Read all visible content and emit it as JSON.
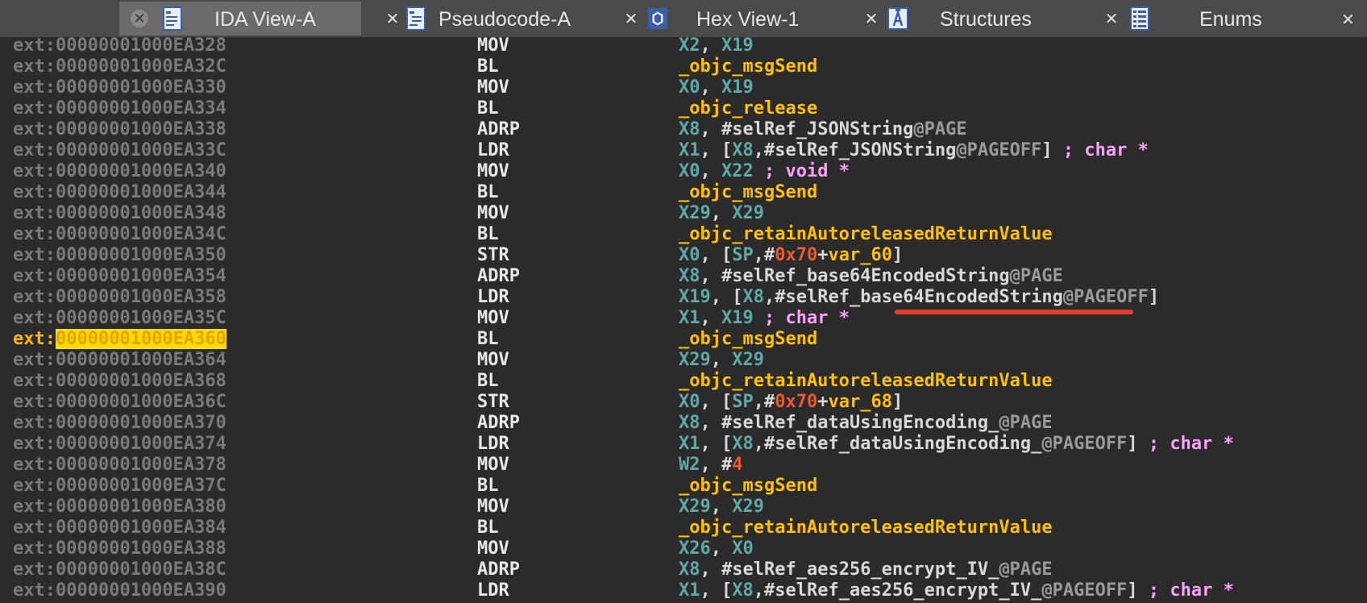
{
  "tabs": [
    {
      "label": "IDA View-A",
      "icon": "ida-view-icon",
      "active": true
    },
    {
      "label": "Pseudocode-A",
      "icon": "pseudocode-icon",
      "active": false
    },
    {
      "label": "Hex View-1",
      "icon": "hex-view-icon",
      "active": false
    },
    {
      "label": "Structures",
      "icon": "structures-icon",
      "active": false
    },
    {
      "label": "Enums",
      "icon": "enums-icon",
      "active": false
    }
  ],
  "colors": {
    "background": "#2b2b2b",
    "address": "#7a7a7a",
    "register": "#5fa8a8",
    "symbol": "#ffc000",
    "number": "#f05a2a",
    "comment": "#ff9eff",
    "highlight": "#ffdd00",
    "annotation_underline": "#e53b2a"
  },
  "listing": {
    "segment": "ext:",
    "current_address": "00000001000EA360",
    "rows": [
      {
        "addr": "ext:00000001000EA328",
        "mnemonic": "MOV",
        "operands": "X2, X19"
      },
      {
        "addr": "ext:00000001000EA32C",
        "mnemonic": "BL",
        "operands": "_objc_msgSend"
      },
      {
        "addr": "ext:00000001000EA330",
        "mnemonic": "MOV",
        "operands": "X0, X19"
      },
      {
        "addr": "ext:00000001000EA334",
        "mnemonic": "BL",
        "operands": "_objc_release"
      },
      {
        "addr": "ext:00000001000EA338",
        "mnemonic": "ADRP",
        "operands": "X8, #selRef_JSONString@PAGE"
      },
      {
        "addr": "ext:00000001000EA33C",
        "mnemonic": "LDR",
        "operands": "X1, [X8,#selRef_JSONString@PAGEOFF] ; char *"
      },
      {
        "addr": "ext:00000001000EA340",
        "mnemonic": "MOV",
        "operands": "X0, X22 ; void *"
      },
      {
        "addr": "ext:00000001000EA344",
        "mnemonic": "BL",
        "operands": "_objc_msgSend"
      },
      {
        "addr": "ext:00000001000EA348",
        "mnemonic": "MOV",
        "operands": "X29, X29"
      },
      {
        "addr": "ext:00000001000EA34C",
        "mnemonic": "BL",
        "operands": "_objc_retainAutoreleasedReturnValue"
      },
      {
        "addr": "ext:00000001000EA350",
        "mnemonic": "STR",
        "operands": "X0, [SP,#0x70+var_60]"
      },
      {
        "addr": "ext:00000001000EA354",
        "mnemonic": "ADRP",
        "operands": "X8, #selRef_base64EncodedString@PAGE"
      },
      {
        "addr": "ext:00000001000EA358",
        "mnemonic": "LDR",
        "operands": "X19, [X8,#selRef_base64EncodedString@PAGEOFF]"
      },
      {
        "addr": "ext:00000001000EA35C",
        "mnemonic": "MOV",
        "operands": "X1, X19 ; char *"
      },
      {
        "addr": "ext:00000001000EA360",
        "mnemonic": "BL",
        "operands": "_objc_msgSend"
      },
      {
        "addr": "ext:00000001000EA364",
        "mnemonic": "MOV",
        "operands": "X29, X29"
      },
      {
        "addr": "ext:00000001000EA368",
        "mnemonic": "BL",
        "operands": "_objc_retainAutoreleasedReturnValue"
      },
      {
        "addr": "ext:00000001000EA36C",
        "mnemonic": "STR",
        "operands": "X0, [SP,#0x70+var_68]"
      },
      {
        "addr": "ext:00000001000EA370",
        "mnemonic": "ADRP",
        "operands": "X8, #selRef_dataUsingEncoding_@PAGE"
      },
      {
        "addr": "ext:00000001000EA374",
        "mnemonic": "LDR",
        "operands": "X1, [X8,#selRef_dataUsingEncoding_@PAGEOFF] ; char *"
      },
      {
        "addr": "ext:00000001000EA378",
        "mnemonic": "MOV",
        "operands": "W2, #4"
      },
      {
        "addr": "ext:00000001000EA37C",
        "mnemonic": "BL",
        "operands": "_objc_msgSend"
      },
      {
        "addr": "ext:00000001000EA380",
        "mnemonic": "MOV",
        "operands": "X29, X29"
      },
      {
        "addr": "ext:00000001000EA384",
        "mnemonic": "BL",
        "operands": "_objc_retainAutoreleasedReturnValue"
      },
      {
        "addr": "ext:00000001000EA388",
        "mnemonic": "MOV",
        "operands": "X26, X0"
      },
      {
        "addr": "ext:00000001000EA38C",
        "mnemonic": "ADRP",
        "operands": "X8, #selRef_aes256_encrypt_IV_@PAGE"
      },
      {
        "addr": "ext:00000001000EA390",
        "mnemonic": "LDR",
        "operands": "X1, [X8,#selRef_aes256_encrypt_IV_@PAGEOFF] ; char *"
      }
    ]
  }
}
